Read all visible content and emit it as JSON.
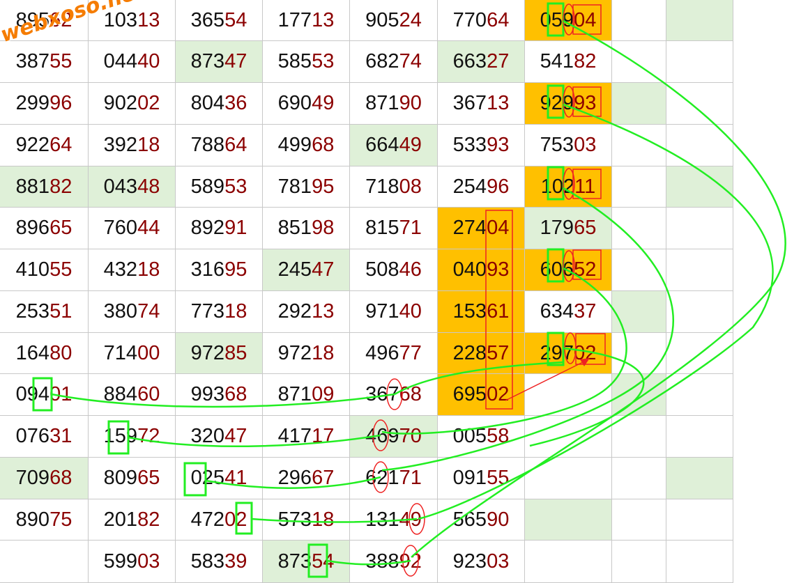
{
  "watermark": "webxoso.net",
  "colors": {
    "grid": "#c8c8c8",
    "plain_bg": "#ffffff",
    "light_green_bg": "#dff0d8",
    "orange_bg": "#ffc000",
    "prefix_text": "#111111",
    "suffix_text": "#8b0000",
    "green_marker": "#22ee22",
    "red_marker": "#ee2222"
  },
  "grid": {
    "row_count": 14,
    "col_count": 9,
    "rows": [
      [
        "89562",
        "10313",
        "36554",
        "17713",
        "90524",
        "77064",
        "05904",
        "",
        ""
      ],
      [
        "38755",
        "04440",
        "87347",
        "58553",
        "68274",
        "66327",
        "54182",
        "",
        ""
      ],
      [
        "29996",
        "90202",
        "80436",
        "69049",
        "87190",
        "36713",
        "92993",
        "",
        ""
      ],
      [
        "92264",
        "39218",
        "78864",
        "49968",
        "66449",
        "53393",
        "75303",
        "",
        ""
      ],
      [
        "88182",
        "04348",
        "58953",
        "78195",
        "71808",
        "25496",
        "10211",
        "",
        ""
      ],
      [
        "89665",
        "76044",
        "89291",
        "85198",
        "81571",
        "27404",
        "17965",
        "",
        ""
      ],
      [
        "41055",
        "43218",
        "31695",
        "24547",
        "50846",
        "04093",
        "60652",
        "",
        ""
      ],
      [
        "25351",
        "38074",
        "77318",
        "29213",
        "97140",
        "15361",
        "63437",
        "",
        ""
      ],
      [
        "16480",
        "71400",
        "97285",
        "97218",
        "49677",
        "22857",
        "29702",
        "",
        ""
      ],
      [
        "09401",
        "88460",
        "99368",
        "87109",
        "36768",
        "69502",
        "",
        "",
        ""
      ],
      [
        "07631",
        "15972",
        "32047",
        "41717",
        "46970",
        "00558",
        "",
        "",
        ""
      ],
      [
        "70968",
        "80965",
        "02541",
        "29667",
        "62171",
        "09155",
        "",
        "",
        ""
      ],
      [
        "89075",
        "20182",
        "47202",
        "57318",
        "13149",
        "56590",
        "",
        "",
        ""
      ],
      [
        "",
        "59903",
        "58339",
        "87354",
        "38892",
        "92303",
        "",
        "",
        ""
      ]
    ],
    "highlight_green": [
      [
        0,
        8
      ],
      [
        1,
        2
      ],
      [
        1,
        5
      ],
      [
        2,
        7
      ],
      [
        3,
        4
      ],
      [
        4,
        0
      ],
      [
        4,
        1
      ],
      [
        4,
        8
      ],
      [
        5,
        6
      ],
      [
        6,
        3
      ],
      [
        7,
        7
      ],
      [
        8,
        2
      ],
      [
        9,
        7
      ],
      [
        10,
        4
      ],
      [
        11,
        0
      ],
      [
        11,
        8
      ],
      [
        12,
        6
      ],
      [
        13,
        3
      ]
    ],
    "highlight_orange": [
      [
        0,
        6
      ],
      [
        2,
        6
      ],
      [
        4,
        6
      ],
      [
        5,
        5
      ],
      [
        6,
        5
      ],
      [
        6,
        6
      ],
      [
        7,
        5
      ],
      [
        8,
        5
      ],
      [
        8,
        6
      ],
      [
        9,
        5
      ]
    ]
  }
}
